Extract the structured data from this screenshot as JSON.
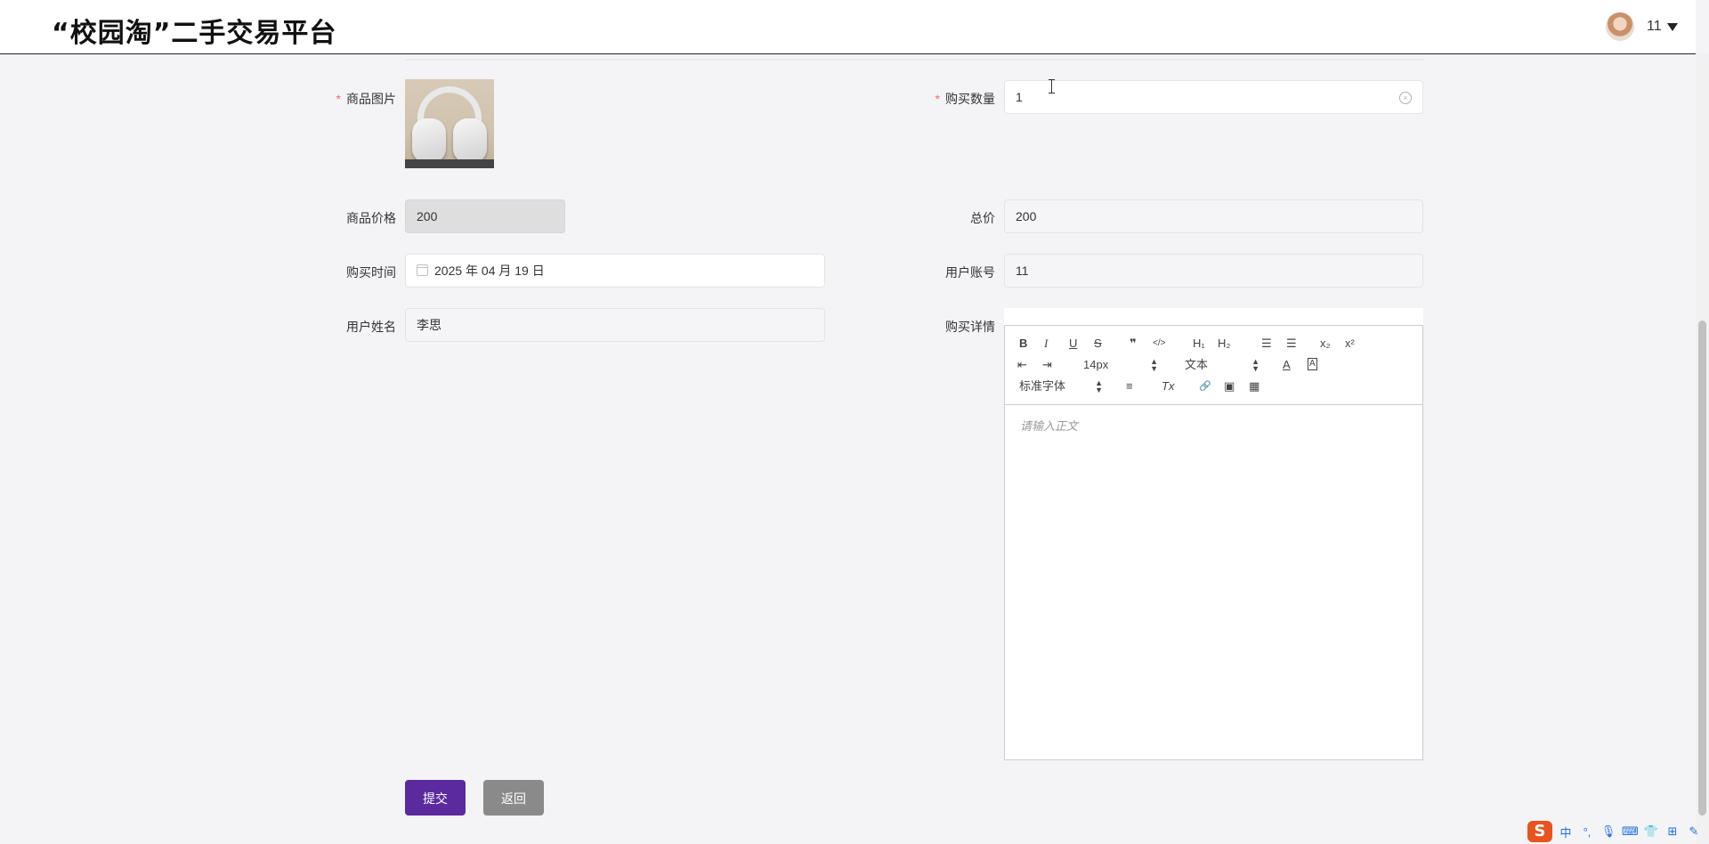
{
  "header": {
    "title": "“校园淘”二手交易平台",
    "username": "11"
  },
  "form": {
    "product_image": {
      "label": "商品图片",
      "required": "*"
    },
    "quantity": {
      "label": "购买数量",
      "required": "*",
      "value": "1"
    },
    "price": {
      "label": "商品价格",
      "value": "200"
    },
    "total": {
      "label": "总价",
      "value": "200"
    },
    "purchase_time": {
      "label": "购买时间",
      "value": "2025 年 04 月 19 日"
    },
    "user_account": {
      "label": "用户账号",
      "value": "11"
    },
    "user_name": {
      "label": "用户姓名",
      "value": "李思"
    },
    "details": {
      "label": "购买详情",
      "placeholder": "请输入正文"
    }
  },
  "editor_toolbar": {
    "bold": "B",
    "italic": "I",
    "underline": "U",
    "strike": "S",
    "quote": "❞",
    "code": "</>",
    "h1": "H₁",
    "h2": "H₂",
    "ordered_list": "☰",
    "bullet_list": "☰",
    "subscript": "x₂",
    "superscript": "x²",
    "outdent": "⇤",
    "indent": "⇥",
    "font_size": "14px",
    "header_select": "文本",
    "font_family": "标准字体",
    "align": "≡",
    "clean": "Tx",
    "link": "🔗",
    "image": "▣",
    "video": "▦",
    "color": "A",
    "background": "A"
  },
  "buttons": {
    "submit": "提交",
    "back": "返回"
  },
  "ime": {
    "logo": "S",
    "lang": "中",
    "punct": "°,",
    "mic": "🎙",
    "keyboard": "⌨",
    "skin": "👕",
    "grid": "⊞",
    "tool": "✎"
  }
}
